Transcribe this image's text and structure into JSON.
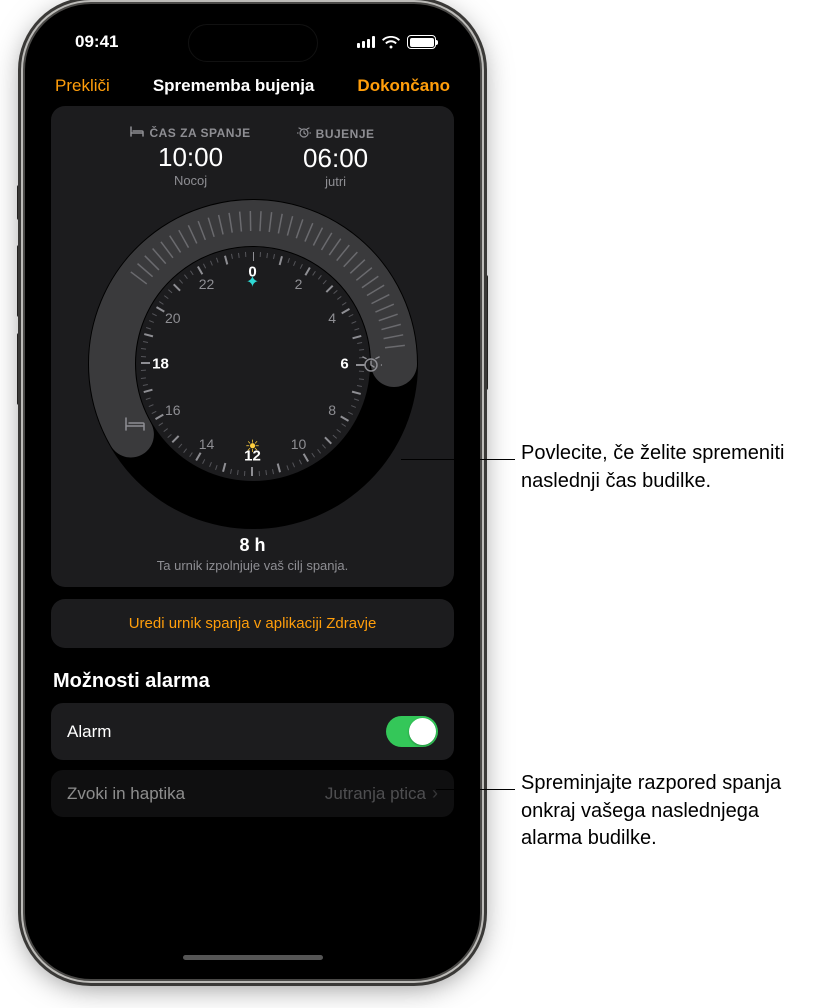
{
  "statusbar": {
    "time": "09:41"
  },
  "nav": {
    "cancel": "Prekliči",
    "title": "Sprememba bujenja",
    "done": "Dokončano"
  },
  "bedtime": {
    "label": "ČAS ZA SPANJE",
    "time": "10:00",
    "sub": "Nocoj"
  },
  "wake": {
    "label": "BUJENJE",
    "time": "06:00",
    "sub": "jutri"
  },
  "dial": {
    "hours": [
      "0",
      "2",
      "4",
      "6",
      "8",
      "10",
      "12",
      "14",
      "16",
      "18",
      "20",
      "22"
    ]
  },
  "duration": {
    "hours": "8 h",
    "msg": "Ta urnik izpolnjuje vaš cilj spanja."
  },
  "edit_link": "Uredi urnik spanja v aplikaciji Zdravje",
  "options_header": "Možnosti alarma",
  "alarm_row": {
    "label": "Alarm"
  },
  "sound_row": {
    "label": "Zvoki in haptika",
    "value": "Jutranja ptica"
  },
  "callouts": {
    "c1": "Povlecite, če želite spremeniti naslednji čas budilke.",
    "c2": "Spreminjajte razpored spanja onkraj vašega naslednjega alarma budilke."
  }
}
